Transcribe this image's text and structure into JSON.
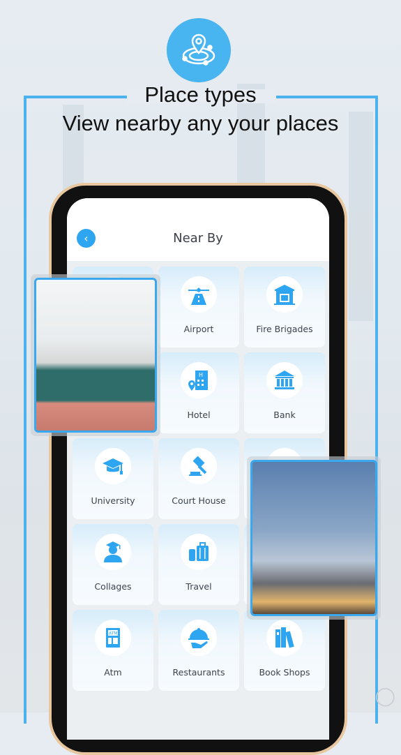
{
  "header": {
    "badge_icon": "location-radar-icon",
    "title": "Place types",
    "subtitle": "View nearby any your places"
  },
  "app": {
    "title": "Near By",
    "back_icon": "chevron-left-icon",
    "accent_color": "#2ea5f0",
    "categories": [
      {
        "label": "",
        "icon": "hidden-icon"
      },
      {
        "label": "Airport",
        "icon": "airport-runway-icon"
      },
      {
        "label": "Fire Brigades",
        "icon": "fire-station-icon"
      },
      {
        "label": "",
        "icon": "hidden-icon"
      },
      {
        "label": "Hotel",
        "icon": "hotel-icon"
      },
      {
        "label": "Bank",
        "icon": "bank-icon"
      },
      {
        "label": "University",
        "icon": "graduation-cap-icon"
      },
      {
        "label": "Court House",
        "icon": "gavel-icon"
      },
      {
        "label": "",
        "icon": "hidden-icon"
      },
      {
        "label": "Collages",
        "icon": "graduate-icon"
      },
      {
        "label": "Travel",
        "icon": "luggage-icon"
      },
      {
        "label": "",
        "icon": "hidden-icon"
      },
      {
        "label": "Atm",
        "icon": "atm-icon"
      },
      {
        "label": "Restaurants",
        "icon": "cloche-icon"
      },
      {
        "label": "Book Shops",
        "icon": "books-icon"
      }
    ]
  },
  "photos": [
    {
      "name": "museum-gallery-photo"
    },
    {
      "name": "kazan-mosque-photo"
    }
  ]
}
